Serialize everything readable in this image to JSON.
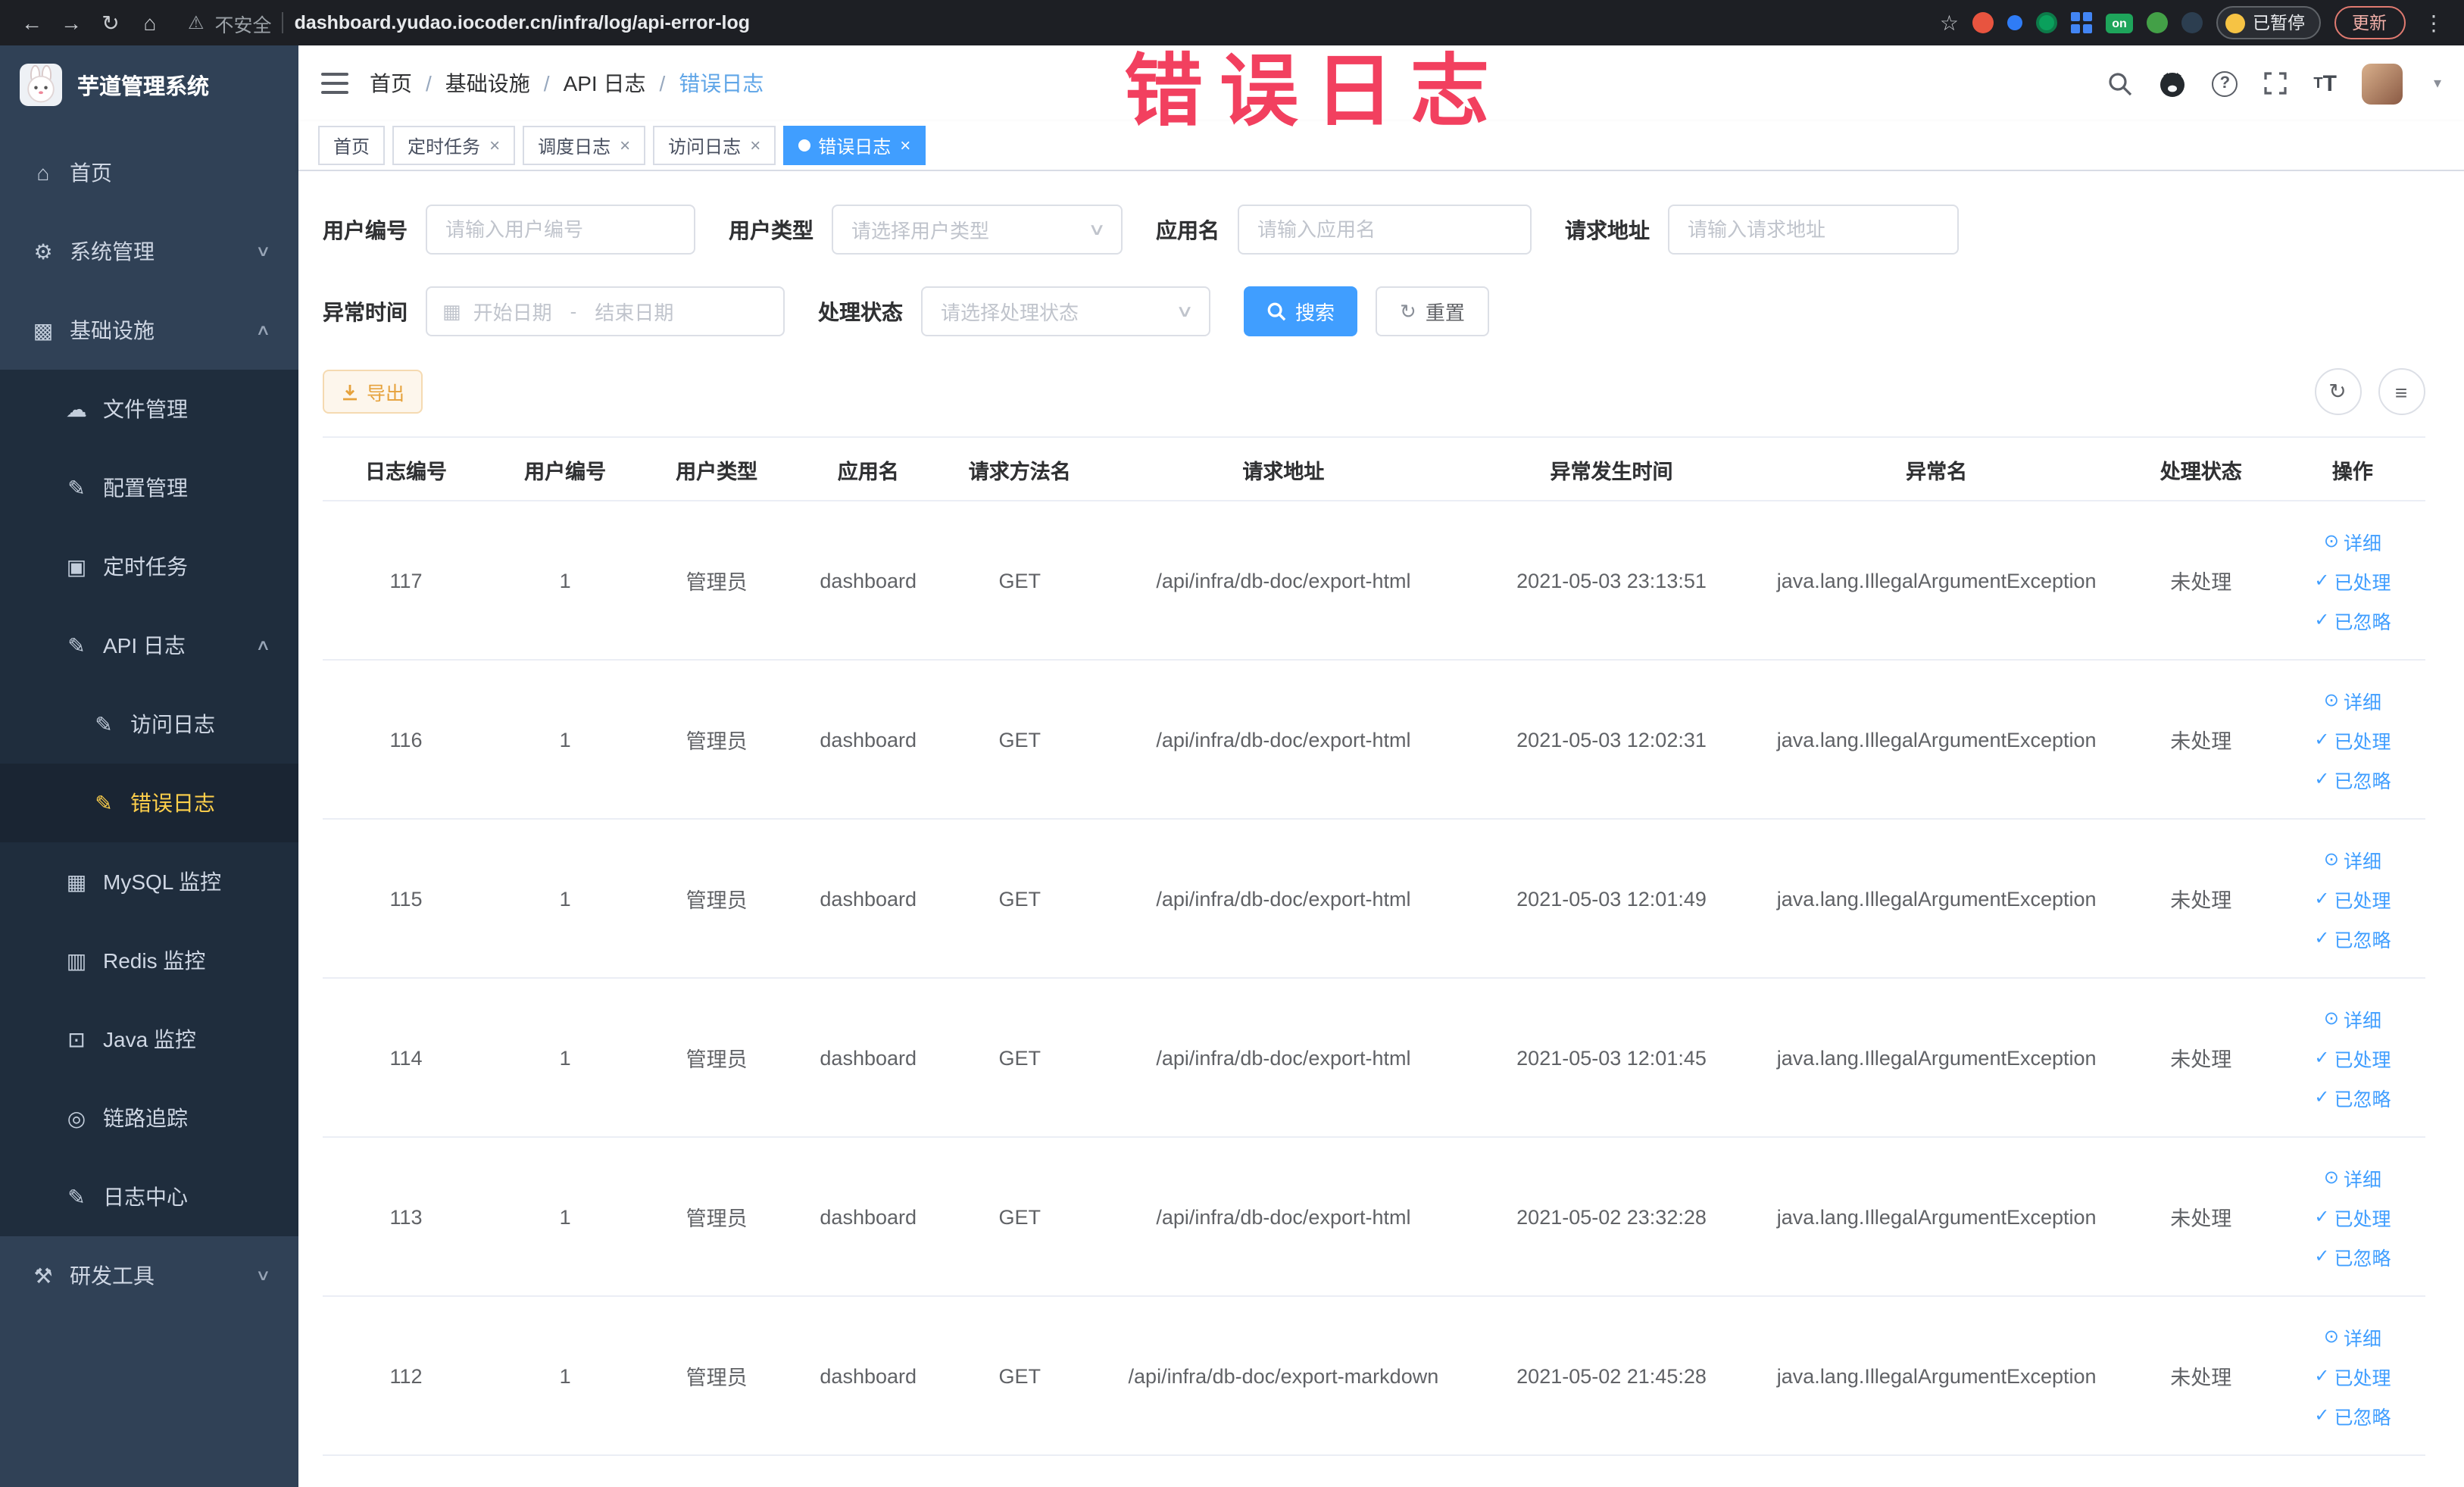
{
  "overlay": {
    "title": "错误日志"
  },
  "browser": {
    "security_label": "不安全",
    "url": "dashboard.yudao.iocoder.cn/infra/log/api-error-log",
    "paused_badge": "已暂停",
    "update_button": "更新",
    "on_badge": "on"
  },
  "icons": {
    "back": "←",
    "forward": "→",
    "reload": "↻",
    "home": "⌂",
    "warning": "⚠",
    "star": "☆",
    "more": "⋮",
    "chevron_down": "∨",
    "chevron_up": "∧",
    "caret_down": "▾",
    "close": "×",
    "menu_home": "⌂",
    "menu_system": "⚙",
    "menu_infra": "▩",
    "menu_file": "☁",
    "menu_config": "✎",
    "menu_job": "▣",
    "menu_api_log": "✎",
    "menu_doc": "✎",
    "menu_mysql": "▦",
    "menu_redis": "▥",
    "menu_java": "⊡",
    "menu_trace": "◎",
    "menu_log_center": "✎",
    "menu_tools": "⚒",
    "calendar": "▦",
    "refresh": "↻",
    "columns": "≡",
    "eye": "⊙",
    "check": "✓",
    "reset": "↻"
  },
  "sidebar": {
    "logo_title": "芋道管理系统",
    "items": {
      "home": "首页",
      "system": "系统管理",
      "infra": "基础设施",
      "file": "文件管理",
      "config": "配置管理",
      "job": "定时任务",
      "api_log": "API 日志",
      "access_log": "访问日志",
      "error_log": "错误日志",
      "mysql": "MySQL 监控",
      "redis": "Redis 监控",
      "java": "Java 监控",
      "trace": "链路追踪",
      "log_center": "日志中心",
      "dev_tools": "研发工具"
    }
  },
  "header": {
    "breadcrumb": [
      "首页",
      "基础设施",
      "API 日志",
      "错误日志"
    ],
    "separator": "/"
  },
  "tabs": [
    "首页",
    "定时任务",
    "调度日志",
    "访问日志",
    "错误日志"
  ],
  "filters": {
    "user_id_label": "用户编号",
    "user_id_placeholder": "请输入用户编号",
    "user_type_label": "用户类型",
    "user_type_placeholder": "请选择用户类型",
    "app_name_label": "应用名",
    "app_name_placeholder": "请输入应用名",
    "request_url_label": "请求地址",
    "request_url_placeholder": "请输入请求地址",
    "exception_time_label": "异常时间",
    "date_start_placeholder": "开始日期",
    "date_separator": "-",
    "date_end_placeholder": "结束日期",
    "process_status_label": "处理状态",
    "process_status_placeholder": "请选择处理状态",
    "search_button": "搜索",
    "reset_button": "重置"
  },
  "toolbar": {
    "export_button": "导出"
  },
  "table": {
    "columns": [
      "日志编号",
      "用户编号",
      "用户类型",
      "应用名",
      "请求方法名",
      "请求地址",
      "异常发生时间",
      "异常名",
      "处理状态",
      "操作"
    ],
    "actions": {
      "detail": "详细",
      "processed": "已处理",
      "ignored": "已忽略"
    },
    "rows": [
      {
        "id": "117",
        "user_id": "1",
        "user_type": "管理员",
        "app": "dashboard",
        "method": "GET",
        "url": "/api/infra/db-doc/export-html",
        "time": "2021-05-03 23:13:51",
        "exception": "java.lang.IllegalArgumentException",
        "status": "未处理"
      },
      {
        "id": "116",
        "user_id": "1",
        "user_type": "管理员",
        "app": "dashboard",
        "method": "GET",
        "url": "/api/infra/db-doc/export-html",
        "time": "2021-05-03 12:02:31",
        "exception": "java.lang.IllegalArgumentException",
        "status": "未处理"
      },
      {
        "id": "115",
        "user_id": "1",
        "user_type": "管理员",
        "app": "dashboard",
        "method": "GET",
        "url": "/api/infra/db-doc/export-html",
        "time": "2021-05-03 12:01:49",
        "exception": "java.lang.IllegalArgumentException",
        "status": "未处理"
      },
      {
        "id": "114",
        "user_id": "1",
        "user_type": "管理员",
        "app": "dashboard",
        "method": "GET",
        "url": "/api/infra/db-doc/export-html",
        "time": "2021-05-03 12:01:45",
        "exception": "java.lang.IllegalArgumentException",
        "status": "未处理"
      },
      {
        "id": "113",
        "user_id": "1",
        "user_type": "管理员",
        "app": "dashboard",
        "method": "GET",
        "url": "/api/infra/db-doc/export-html",
        "time": "2021-05-02 23:32:28",
        "exception": "java.lang.IllegalArgumentException",
        "status": "未处理"
      },
      {
        "id": "112",
        "user_id": "1",
        "user_type": "管理员",
        "app": "dashboard",
        "method": "GET",
        "url": "/api/infra/db-doc/export-markdown",
        "time": "2021-05-02 21:45:28",
        "exception": "java.lang.IllegalArgumentException",
        "status": "未处理"
      }
    ]
  }
}
